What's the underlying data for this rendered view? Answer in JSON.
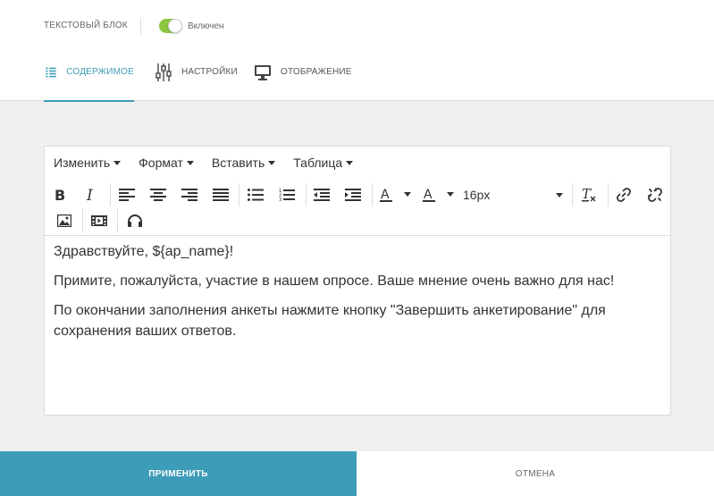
{
  "header": {
    "block_title": "ТЕКСТОВЫЙ БЛОК",
    "toggle_label": "Включен",
    "toggle_on": true
  },
  "tabs": [
    {
      "label": "СОДЕРЖИМОЕ",
      "icon": "list-icon",
      "active": true
    },
    {
      "label": "НАСТРОЙКИ",
      "icon": "sliders-icon",
      "active": false
    },
    {
      "label": "ОТОБРАЖЕНИЕ",
      "icon": "monitor-icon",
      "active": false
    }
  ],
  "editor": {
    "menus": [
      "Изменить",
      "Формат",
      "Вставить",
      "Таблица"
    ],
    "font_size": "16px",
    "paragraphs": [
      "Здравствуйте, ${ap_name}!",
      "Примите, пожалуйста, участие в нашем опросе. Ваше мнение очень важно для нас!",
      "По окончании заполнения анкеты нажмите кнопку \"Завершить анкетирование\" для сохранения ваших ответов."
    ]
  },
  "footer": {
    "apply_label": "ПРИМЕНИТЬ",
    "cancel_label": "ОТМЕНА"
  },
  "colors": {
    "accent": "#3d9cb8",
    "toggle_on": "#8dc63f"
  }
}
